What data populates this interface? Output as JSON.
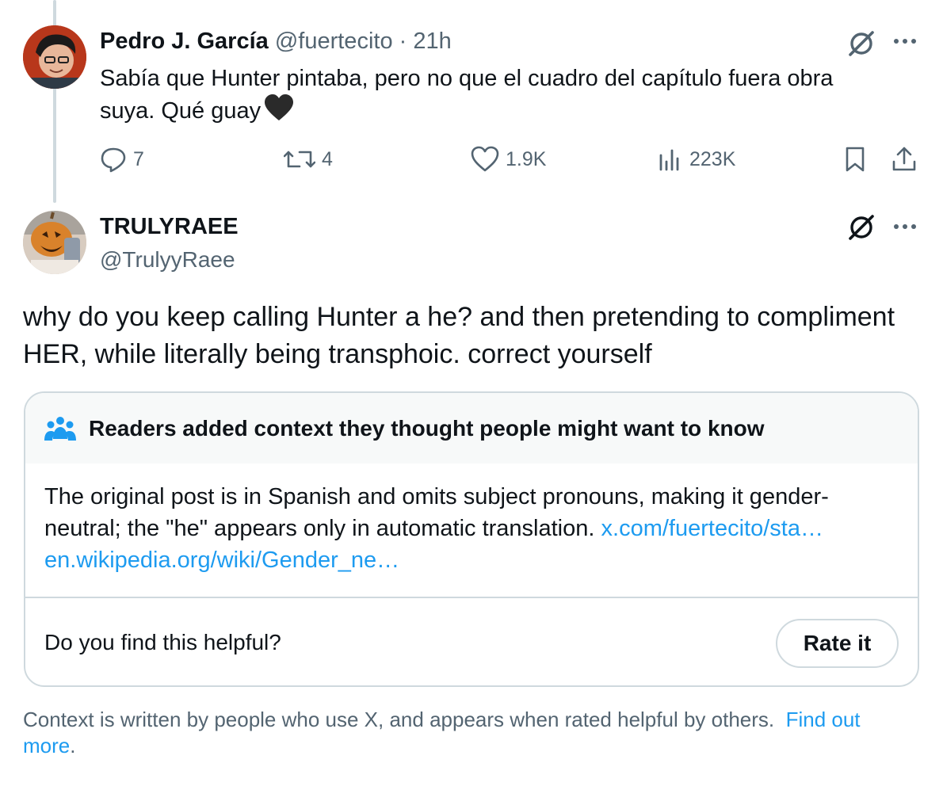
{
  "reply_to_post": {
    "author_name": "Pedro J. García",
    "author_handle": "@fuertecito",
    "separator": "·",
    "time_ago": "21h",
    "text": "Sabía que Hunter pintaba, pero no que el cuadro del capítulo fuera obra suya. Qué guay",
    "emoji": "black-heart",
    "actions": {
      "replies": "7",
      "reposts": "4",
      "likes": "1.9K",
      "views": "223K"
    }
  },
  "main_post": {
    "author_name": "TRULYRAEE",
    "author_handle": "@TrulyyRaee",
    "text": "why do you keep calling Hunter a he? and then pretending to compliment HER, while literally being transphoic. correct yourself"
  },
  "community_note": {
    "header": "Readers added context they thought people might want to know",
    "body": "The original post is in Spanish and omits subject pronouns, making it gender-neutral; the \"he\" appears only in automatic translation.",
    "link1": "x.com/fuertecito/sta…",
    "link2": "en.wikipedia.org/wiki/Gender_ne…",
    "helpful_question": "Do you find this helpful?",
    "rate_button": "Rate it"
  },
  "footer": {
    "text": "Context is written by people who use X, and appears when rated helpful by others.",
    "link": "Find out more",
    "period": "."
  },
  "colors": {
    "accent": "#1d9bf0",
    "secondary_text": "#536471",
    "border": "#cfd9de",
    "note_header_bg": "#f7f9f9"
  }
}
